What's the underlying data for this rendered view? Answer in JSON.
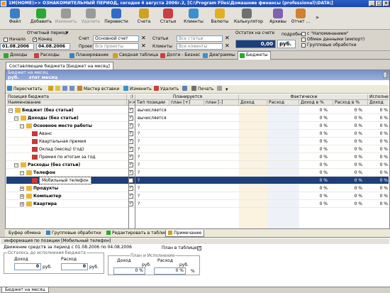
{
  "window": {
    "title": "1М(HOME)>> ОЗНАКОМИТЕЛЬНЫЙ ПЕРИОД, сегодня 4 августа 2006г.2, [C:\\Program Files\\Домашние финансы (professional)\\DATA\\]",
    "minimize": "_",
    "maximize": "□",
    "close": "×"
  },
  "toolbar": {
    "buttons": [
      {
        "label": "Файл",
        "color": "#3b7fc8",
        "disabled": false
      },
      {
        "label": "Добавить",
        "color": "#2aa830",
        "disabled": false
      },
      {
        "label": "Изменить",
        "color": "#9a9a9a",
        "disabled": true
      },
      {
        "label": "Удалить",
        "color": "#9a9a9a",
        "disabled": true
      },
      {
        "label": "Перевести",
        "color": "#2f6cc8",
        "disabled": false
      },
      {
        "label": "Счета",
        "color": "#d0a020",
        "disabled": false
      },
      {
        "label": "Статьи",
        "color": "#c84040",
        "disabled": false
      },
      {
        "label": "Клиенты",
        "color": "#3a90d0",
        "disabled": false
      },
      {
        "label": "Валюты",
        "color": "#e0b020",
        "disabled": false
      },
      {
        "label": "Калькулятор",
        "color": "#707070",
        "disabled": false
      },
      {
        "label": "Архивы",
        "color": "#8060b0",
        "disabled": false
      },
      {
        "label": "Отчет ...",
        "color": "#d08030",
        "disabled": false
      }
    ]
  },
  "filters": {
    "period_label": "Отчетный период",
    "start_label": "Начало",
    "end_label": "Конец",
    "start_date": "01.08.2006",
    "end_date": "04.08.2006",
    "account_label": "Счет",
    "account_value": "Основной счет",
    "project_label": "Проект",
    "project_value": "Все проекты",
    "articles_label": "Статьи",
    "articles_value": "Все статьи",
    "clients_label": "Клиенты",
    "clients_value": "Все клиенты",
    "balance_label": "Остаток на счете",
    "balance_value": "0,00",
    "currency": "руб.",
    "detail_label": "подробнее",
    "reminders_label": "с \"Напоминанием\"",
    "exchange_label": "Обмен данными (импорт)",
    "group_label": "Групповые обработки"
  },
  "main_tabs": [
    {
      "label": "Доходы",
      "color": "#2aa830"
    },
    {
      "label": "Расходы",
      "color": "#c84040"
    },
    {
      "label": "Планирование",
      "color": "#3b7fc8"
    },
    {
      "label": "Сводная таблица",
      "color": "#d0a020"
    },
    {
      "label": "Долги - Бизнес",
      "color": "#c84040"
    },
    {
      "label": "Диаграммы",
      "color": "#3a90d0"
    },
    {
      "label": "Бюджеты",
      "color": "#2aa830",
      "active": true
    }
  ],
  "subtab": "Составляющие бюджета [Бюджет на месяц]",
  "panel": {
    "subtitle": "Бюджет на месяц",
    "title": "руб.      этот месяц"
  },
  "grid_toolbar": {
    "recalc": "Пересчитать",
    "wizard": "Мастер вставки",
    "edit": "Изменить",
    "delete": "Удалить",
    "print": "Печать"
  },
  "headers": {
    "position": "Позиция бюджета",
    "name": "Наименование",
    "planned": "Планируется",
    "actual": "Фактически",
    "execution": "Исполне",
    "type": "Тип позиции",
    "plan_plus": "план [+]",
    "plan_minus": "план [-]",
    "income": "Доход",
    "expense": "Расход",
    "income_pct": "Доход в %",
    "expense_pct": "Расход в %",
    "income2": "Доход",
    "col_a": ":)",
    "col_b": ">>"
  },
  "rows": [
    {
      "name": "Бюджет (без статьи)",
      "level": 0,
      "bold": true,
      "plus": "−",
      "icon": "folder",
      "type": "вычисляется",
      "income_pct": "0 %",
      "expense_pct": "0 %",
      "last": "0 %"
    },
    {
      "name": "Доходы (без статьи)",
      "level": 1,
      "bold": true,
      "plus": "−",
      "icon": "folder",
      "type": "вычисляется",
      "income_pct": "0 %",
      "expense_pct": "0 %",
      "last": "0 %"
    },
    {
      "name": "Основное место работы",
      "level": 2,
      "bold": true,
      "plus": "−",
      "icon": "folder",
      "type": "?",
      "income_pct": "0 %",
      "expense_pct": "0 %",
      "last": "0 %"
    },
    {
      "name": "Аванс",
      "level": 3,
      "bold": false,
      "plus": "",
      "icon": "item",
      "type": "?",
      "income_pct": "0 %",
      "expense_pct": "0 %",
      "last": "0 %"
    },
    {
      "name": "Квартальная премия",
      "level": 3,
      "bold": false,
      "plus": "",
      "icon": "item",
      "type": "?",
      "income_pct": "0 %",
      "expense_pct": "0 %",
      "last": "0 %"
    },
    {
      "name": "Оклад (месяц) (год)",
      "level": 3,
      "bold": false,
      "plus": "",
      "icon": "item",
      "type": "?",
      "income_pct": "0 %",
      "expense_pct": "0 %",
      "last": "0 %"
    },
    {
      "name": "Премия по итогам за год",
      "level": 3,
      "bold": false,
      "plus": "",
      "icon": "item",
      "type": "?",
      "income_pct": "0 %",
      "expense_pct": "0 %",
      "last": "0 %"
    },
    {
      "name": "Расходы (без статьи)",
      "level": 1,
      "bold": true,
      "plus": "−",
      "icon": "folder",
      "type": "?",
      "income_pct": "0 %",
      "expense_pct": "0 %",
      "last": "0 %"
    },
    {
      "name": "Телефон",
      "level": 2,
      "bold": true,
      "plus": "−",
      "icon": "folder",
      "type": "?",
      "income_pct": "0 %",
      "expense_pct": "0 %",
      "last": "0 %"
    },
    {
      "name": "Мобильный телефон",
      "level": 3,
      "bold": false,
      "plus": "",
      "icon": "item",
      "type": "?",
      "income_pct": "0 %",
      "expense_pct": "0 %",
      "last": "0 %",
      "selected": true
    },
    {
      "name": "Продукты",
      "level": 2,
      "bold": true,
      "plus": "+",
      "icon": "folder",
      "type": "?",
      "income_pct": "0 %",
      "expense_pct": "0 %",
      "last": "0 %"
    },
    {
      "name": "Компьютер",
      "level": 2,
      "bold": true,
      "plus": "+",
      "icon": "folder",
      "type": "?",
      "income_pct": "0 %",
      "expense_pct": "0 %",
      "last": "0 %"
    },
    {
      "name": "Квартира",
      "level": 2,
      "bold": true,
      "plus": "+",
      "icon": "folder",
      "type": "?",
      "income_pct": "0 %",
      "expense_pct": "0 %",
      "last": "0 %"
    }
  ],
  "bottom_tabs": {
    "clipboard": "Буфер обмена",
    "group": "Групповые обработки",
    "edit_table": "Редактировать в таблице",
    "note": "Примечание"
  },
  "info": {
    "title": "информация по позиции [Мобильный телефон]",
    "movement": "Движение средств за период с 01.08.2006 по 04.08.2006",
    "in_table": "План в таблице",
    "remaining": "Осталось до исполнения бюджета",
    "plan_exec": "План и Исполнение",
    "income_label": "Доход",
    "expense_label": "Расход",
    "income_val": "0",
    "expense_val": "0",
    "rub": "руб.",
    "pct1": "0 %",
    "pct2": "0 %",
    "pct_sign": "%"
  },
  "statusbar": "Бюджет на месяц"
}
